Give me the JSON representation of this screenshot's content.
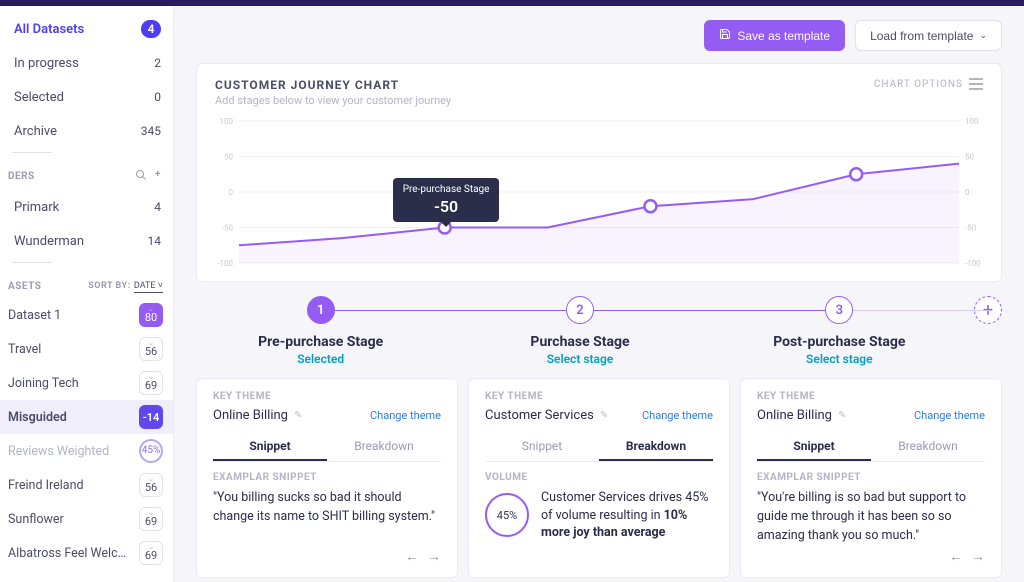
{
  "header": {
    "save_template": "Save as template",
    "load_template": "Load from template"
  },
  "sidebar": {
    "statuses": [
      {
        "label": "All Datasets",
        "count": "4",
        "active": true
      },
      {
        "label": "In progress",
        "count": "2"
      },
      {
        "label": "Selected",
        "count": "0"
      },
      {
        "label": "Archive",
        "count": "345"
      }
    ],
    "section_label_ders": "DERS",
    "folders": [
      {
        "label": "Primark",
        "count": "4"
      },
      {
        "label": "Wunderman",
        "count": "14"
      }
    ],
    "section_label_asets": "ASETS",
    "sort_label": "SORT BY:",
    "sort_value": "DATE",
    "datasets": [
      {
        "label": "Dataset 1",
        "value": "80",
        "style": "purple"
      },
      {
        "label": "Travel",
        "value": "56"
      },
      {
        "label": "Joining Tech",
        "value": "69"
      },
      {
        "label": "Misguided",
        "value": "-14",
        "style": "purple-dark",
        "selected": true
      },
      {
        "label": "Reviews Weighted",
        "value": "45%",
        "style": "outline-circle",
        "muted": true
      },
      {
        "label": "Freind Ireland",
        "value": "56"
      },
      {
        "label": "Sunflower",
        "value": "69"
      },
      {
        "label": "Albatross Feel Welcome L..",
        "value": "69"
      }
    ]
  },
  "chart": {
    "title": "CUSTOMER JOURNEY CHART",
    "subtitle": "Add stages below to view your customer journey",
    "options_label": "CHART OPTIONS",
    "tooltip_label": "Pre-purchase Stage",
    "tooltip_value": "-50"
  },
  "chart_data": {
    "type": "line",
    "title": "Customer Journey Chart",
    "ylabel": "",
    "ylim": [
      -100,
      100
    ],
    "yticks": [
      -100,
      -50,
      0,
      50,
      100
    ],
    "x": [
      0,
      1,
      2,
      3,
      4,
      5,
      6,
      7
    ],
    "values": [
      -75,
      -65,
      -50,
      -50,
      -20,
      -10,
      25,
      40
    ],
    "markers_at": [
      2,
      4,
      6
    ],
    "stages": [
      {
        "index": 2,
        "name": "Pre-purchase Stage",
        "value": -50
      },
      {
        "index": 4,
        "name": "Purchase Stage",
        "value": -20
      },
      {
        "index": 6,
        "name": "Post-purchase Stage",
        "value": 25
      }
    ]
  },
  "stages": [
    {
      "num": "1",
      "title": "Pre-purchase Stage",
      "status": "Selected",
      "active": true
    },
    {
      "num": "2",
      "title": "Purchase Stage",
      "status": "Select stage"
    },
    {
      "num": "3",
      "title": "Post-purchase Stage",
      "status": "Select stage"
    }
  ],
  "stage_cards": [
    {
      "key_label": "KEY THEME",
      "theme": "Online Billing",
      "change_link": "Change theme",
      "tab_snippet": "Snippet",
      "tab_breakdown": "Breakdown",
      "active_tab": "snippet",
      "body_label": "EXAMPLAR SNIPPET",
      "snippet": "\"You billing sucks so bad it should change its name to SHIT billing system.\""
    },
    {
      "key_label": "KEY THEME",
      "theme": "Customer Services",
      "change_link": "Change theme",
      "tab_snippet": "Snippet",
      "tab_breakdown": "Breakdown",
      "active_tab": "breakdown",
      "body_label": "VOLUME",
      "volume_value": "45%",
      "volume_text_prefix": "Customer Services drives 45% of volume resulting in ",
      "volume_text_bold": "10% more joy than average"
    },
    {
      "key_label": "KEY THEME",
      "theme": "Online Billing",
      "change_link": "Change theme",
      "tab_snippet": "Snippet",
      "tab_breakdown": "Breakdown",
      "active_tab": "snippet",
      "body_label": "EXAMPLAR SNIPPET",
      "snippet": "\"You're billing is so bad but support to guide me through it has been so so amazing thank you so much.\""
    }
  ]
}
